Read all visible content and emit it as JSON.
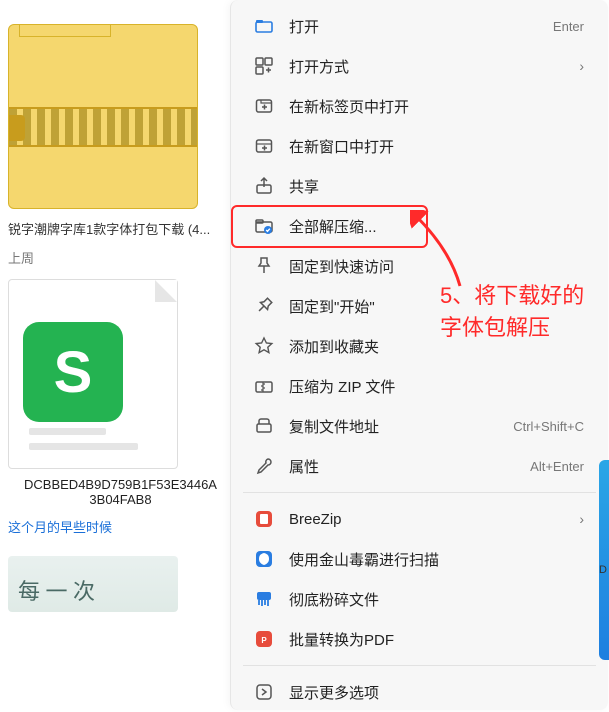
{
  "files": {
    "zip_label": "锐字潮牌字库1款字体打包下载 (4...",
    "section_last_week": "上周",
    "doc_label_line1": "DCBBED4B9D759B1F53E3446A",
    "doc_label_line2": "3B04FAB8",
    "section_earlier": "这个月的早些时候",
    "bottom_thumb_text": "每 一 次"
  },
  "menu": {
    "items": [
      {
        "label": "打开",
        "shortcut": "Enter",
        "icon": "open-icon"
      },
      {
        "label": "打开方式",
        "submenu": true,
        "icon": "open-with-icon"
      },
      {
        "label": "在新标签页中打开",
        "icon": "new-tab-icon"
      },
      {
        "label": "在新窗口中打开",
        "icon": "new-window-icon"
      },
      {
        "label": "共享",
        "icon": "share-icon"
      },
      {
        "label": "全部解压缩...",
        "icon": "extract-all-icon"
      },
      {
        "label": "固定到快速访问",
        "icon": "pin-quick-icon"
      },
      {
        "label": "固定到\"开始\"",
        "icon": "pin-start-icon"
      },
      {
        "label": "添加到收藏夹",
        "icon": "favorite-icon"
      },
      {
        "label": "压缩为 ZIP 文件",
        "icon": "compress-icon"
      },
      {
        "label": "复制文件地址",
        "shortcut": "Ctrl+Shift+C",
        "icon": "copy-path-icon"
      },
      {
        "label": "属性",
        "shortcut": "Alt+Enter",
        "icon": "properties-icon"
      }
    ],
    "third_party": [
      {
        "label": "BreeZip",
        "submenu": true,
        "icon": "breezip-icon"
      },
      {
        "label": "使用金山毒霸进行扫描",
        "icon": "duba-scan-icon"
      },
      {
        "label": "彻底粉碎文件",
        "icon": "shred-icon"
      },
      {
        "label": "批量转换为PDF",
        "icon": "pdf-convert-icon"
      }
    ],
    "more": {
      "label": "显示更多选项",
      "icon": "more-options-icon"
    }
  },
  "annotation": {
    "text": "5、将下载好的字体包解压"
  },
  "right_edge_label": "D"
}
